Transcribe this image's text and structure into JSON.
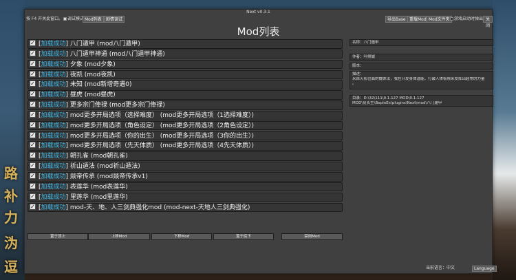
{
  "window": {
    "title": "Next v0.3.1"
  },
  "topbar": {
    "hint": "按 F4 开关此窗口。",
    "debug_mode_label": "调试模式",
    "debug_mode_checked": true,
    "mod_list_tab": "Mod列表",
    "plot_debug_button": "剧情调试",
    "export_base_button": "导出Base",
    "reload_mod_button": "重载Mod",
    "mod_folder_button": "Mod文件夹",
    "auto_popup_label": "游戏启动时弹出",
    "auto_popup_checked": false,
    "close_button": "关闭"
  },
  "main": {
    "title": "Mod列表"
  },
  "mods": [
    {
      "status": "加载成功",
      "name": "八门遁甲 (mod八门遁甲)",
      "checked": true
    },
    {
      "status": "加载成功",
      "name": "八门遁甲神通 (mod八门遁甲神通)",
      "checked": true
    },
    {
      "status": "加载成功",
      "name": "夕象 (mod夕象)",
      "checked": true
    },
    {
      "status": "加载成功",
      "name": "夜凯 (mod夜凯)",
      "checked": true
    },
    {
      "status": "加载成功",
      "name": "未知 (mod新增奇遇0)",
      "checked": true
    },
    {
      "status": "加载成功",
      "name": "昼虎 (mod昼虎)",
      "checked": true
    },
    {
      "status": "加载成功",
      "name": "更多宗门俸禄 (mod更多宗门俸禄)",
      "checked": true
    },
    {
      "status": "加载成功",
      "name": "mod更多开局选项（选择难度） (mod更多开局选项（1选择难度）)",
      "checked": true
    },
    {
      "status": "加载成功",
      "name": "mod更多开局选项（角色设定） (mod更多开局选项（2角色设定）)",
      "checked": true
    },
    {
      "status": "加载成功",
      "name": "mod更多开局选项（你的出生） (mod更多开局选项（3你的出生）)",
      "checked": true
    },
    {
      "status": "加载成功",
      "name": "mod更多开局选项（先天体质） (mod更多开局选项（4先天体质）)",
      "checked": true
    },
    {
      "status": "加载成功",
      "name": "朝孔雀 (mod朝孔雀)",
      "checked": true
    },
    {
      "status": "加载成功",
      "name": "祈山遁法 (mod祈山遁法)",
      "checked": true
    },
    {
      "status": "加载成功",
      "name": "燚帝传承 (mod燚帝传承v1)",
      "checked": true
    },
    {
      "status": "加载成功",
      "name": "表莲华 (mod表莲华)",
      "checked": true
    },
    {
      "status": "加载成功",
      "name": "里莲华 (mod里莲华)",
      "checked": true
    },
    {
      "status": "加载成功",
      "name": "mod-天、地、人三剑典强化mod (mod-next-天地人三剑典强化)",
      "checked": true
    }
  ],
  "buttons": {
    "move_top": "置于顶上",
    "move_up": "上移Mod",
    "move_down": "下移Mod",
    "move_bottom": "置于底下",
    "disable": "禁用Mod"
  },
  "info": {
    "name": "名称：八门遁甲",
    "author": "作者：叶倾城",
    "version": "版本：",
    "desc_line1": "描述：",
    "desc_line2": "来自火影位面的魏体法，我在开发身体潜能，打破人体极限来发挥出超常的力量",
    "desc_line3": "。",
    "dir_line1": "目录：D:\\32\\111\\0.1.127 MOD\\0.1.127",
    "dir_line2": "MOD\\觅长生\\BepInEx\\plugins\\Next\\mod\\八门遁甲"
  },
  "footer": {
    "current_lang": "当前语言：中文",
    "lang_button": "Language"
  },
  "background": {
    "glyphs": [
      "路",
      "补",
      "力",
      "沩",
      "逗"
    ]
  },
  "colors": {
    "status_blue": "#39b6e8",
    "window_bg": "#404040",
    "row_bg": "#353535"
  }
}
